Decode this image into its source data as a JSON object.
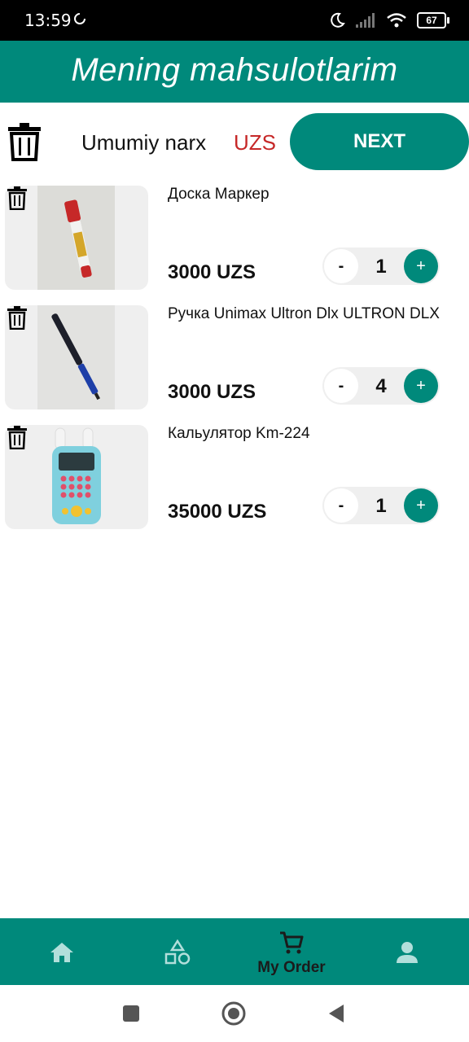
{
  "status_bar": {
    "time": "13:59",
    "battery": "67"
  },
  "app_bar": {
    "title": "Mening mahsulotlarim"
  },
  "summary": {
    "label": "Umumiy narx",
    "currency": "UZS",
    "next_label": "NEXT"
  },
  "items": [
    {
      "name": "Доска Маркер",
      "price": "3000 UZS",
      "quantity": "1",
      "minus": "-",
      "plus": "+"
    },
    {
      "name": "Ручка Unimax Ultron Dlx ULTRON DLX",
      "price": "3000 UZS",
      "quantity": "4",
      "minus": "-",
      "plus": "+"
    },
    {
      "name": "Кальулятор Km-224",
      "price": "35000 UZS",
      "quantity": "1",
      "minus": "-",
      "plus": "+"
    }
  ],
  "bottom_nav": {
    "items": [
      {
        "icon": "home-icon"
      },
      {
        "icon": "categories-icon"
      },
      {
        "icon": "cart-icon",
        "label": "My Order",
        "active": true
      },
      {
        "icon": "profile-icon"
      }
    ]
  },
  "colors": {
    "primary": "#00897b",
    "currency": "#c62828",
    "stepper_bg": "#efefef"
  }
}
